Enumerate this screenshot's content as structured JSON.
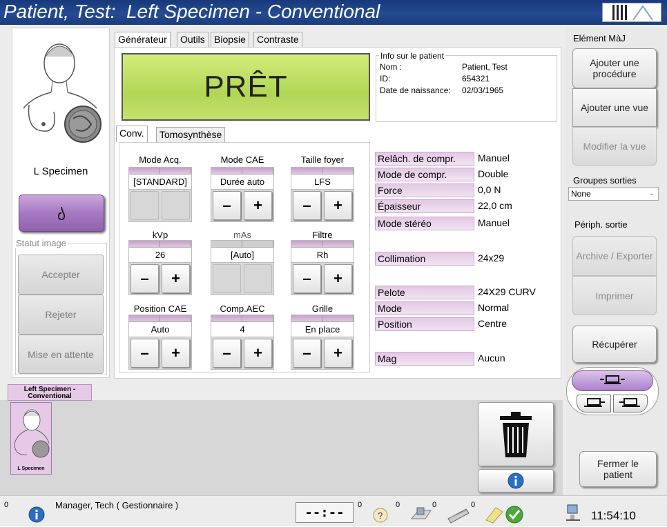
{
  "window": {
    "title_patient": "Patient, Test:",
    "title_procedure": "Left Specimen - Conventional"
  },
  "left": {
    "view_label": "L Specimen",
    "status_group_label": "Statut image",
    "accept": "Accepter",
    "reject": "Rejeter",
    "hold": "Mise en attente"
  },
  "tabs": [
    "Générateur",
    "Outils",
    "Biopsie",
    "Contraste"
  ],
  "ready_text": "PRÊT",
  "patient_info": {
    "group_label": "Info sur le patient",
    "name_label": "Nom :",
    "name_value": "Patient, Test",
    "id_label": "ID:",
    "id_value": "654321",
    "dob_label": "Date de naissance:",
    "dob_value": "02/03/1965"
  },
  "subtabs": [
    "Conv.",
    "Tomosynthèse"
  ],
  "controls": {
    "mode_acq": {
      "label": "Mode Acq.",
      "value": "[STANDARD]"
    },
    "mode_cae": {
      "label": "Mode CAE",
      "value": "Durée auto"
    },
    "taille_foyer": {
      "label": "Taille foyer",
      "value": "LFS"
    },
    "kvp": {
      "label": "kVp",
      "value": "26"
    },
    "mas": {
      "label": "mAs",
      "value": "[Auto]"
    },
    "filtre": {
      "label": "Filtre",
      "value": "Rh"
    },
    "position_cae": {
      "label": "Position CAE",
      "value": "Auto"
    },
    "comp_aec": {
      "label": "Comp.AEC",
      "value": "4"
    },
    "grille": {
      "label": "Grille",
      "value": "En place"
    }
  },
  "params": [
    {
      "label": "Relâch. de compr.",
      "value": "Manuel"
    },
    {
      "label": "Mode de compr.",
      "value": "Double"
    },
    {
      "label": "Force",
      "value": "0,0 N"
    },
    {
      "label": "Épaisseur",
      "value": "22,0 cm"
    },
    {
      "label": "Mode stéréo",
      "value": "Manuel"
    },
    {
      "label": "Collimation",
      "value": "24x29"
    },
    {
      "label": "Pelote",
      "value": "24X29 CURV"
    },
    {
      "label": "Mode",
      "value": "Normal"
    },
    {
      "label": "Position",
      "value": "Centre"
    },
    {
      "label": "Mag",
      "value": "Aucun"
    }
  ],
  "right": {
    "header": "Elément MàJ",
    "add_procedure": "Ajouter une procédure",
    "add_view": "Ajouter une vue",
    "modify_view": "Modifier la vue",
    "output_groups_label": "Groupes sorties",
    "output_groups_value": "None",
    "output_device_label": "Périph. sortie",
    "archive": "Archive / Exporter",
    "print": "Imprimer",
    "retrieve": "Récupérer",
    "close_patient": "Fermer le patient"
  },
  "thumbnail": {
    "procedure_tab": "Left Specimen - Conventional",
    "caption": "L Specimen"
  },
  "statusbar": {
    "alerts_count": "0",
    "user": "Manager, Tech ( Gestionnaire )",
    "timer": "--:--",
    "count1": "0",
    "count2": "0",
    "count3": "0",
    "count4": "0",
    "clock": "11:54:10"
  },
  "colors": {
    "title_bar": "#1f4388",
    "ready_green": "#b8d95c",
    "accent_purple": "#9a6fb0"
  }
}
